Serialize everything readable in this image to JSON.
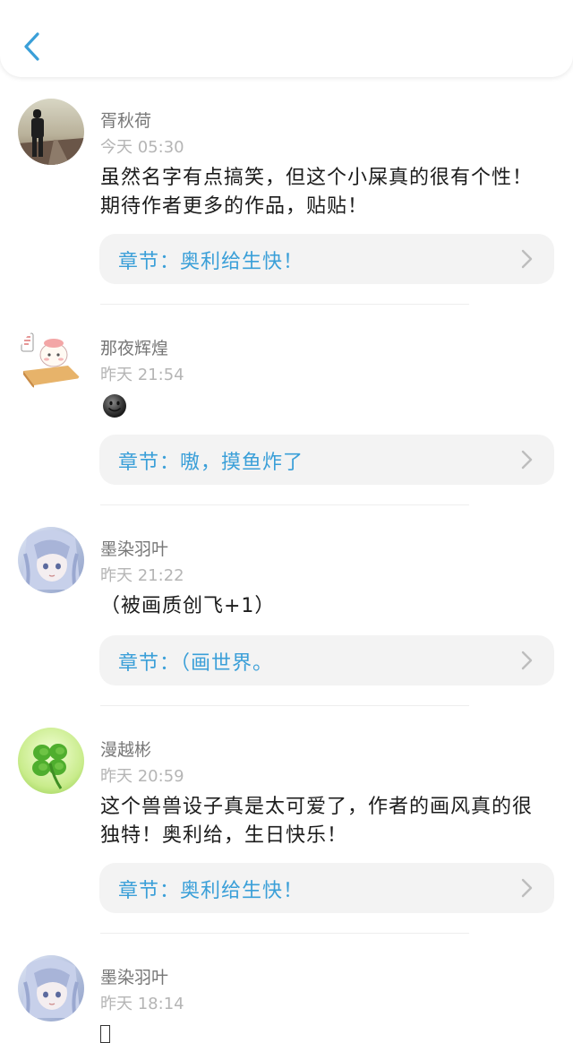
{
  "header": {
    "back_icon": "chevron-left-icon",
    "accent": "#3a9fd8"
  },
  "comments": [
    {
      "name": "胥秋荷",
      "time": "今天 05:30",
      "text": "虽然名字有点搞笑，但这个小屎真的很有个性！期待作者更多的作品，贴贴！",
      "chapter": "章节：奥利给生快！"
    },
    {
      "name": "那夜辉煌",
      "time": "昨天 21:54",
      "emoji": "smiling-face-icon",
      "chapter": "章节：嗷，摸鱼炸了"
    },
    {
      "name": "墨染羽叶",
      "time": "昨天 21:22",
      "text": "（被画质创飞+1）",
      "chapter": "章节：（画世界。"
    },
    {
      "name": "漫越彬",
      "time": "昨天 20:59",
      "text": "这个兽兽设子真是太可爱了，作者的画风真的很独特！奥利给，生日快乐！",
      "chapter": "章节：奥利给生快！"
    },
    {
      "name": "墨染羽叶",
      "time": "昨天 18:14",
      "emoji": "missing-glyph-icon"
    }
  ]
}
